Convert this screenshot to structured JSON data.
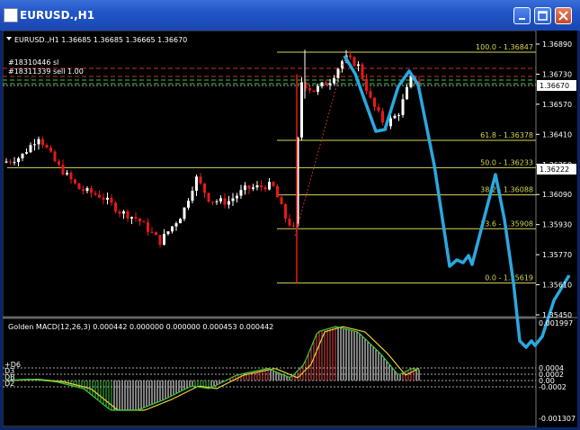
{
  "window": {
    "title": "EURUSD.,H1",
    "buttons": {
      "minimize": "minimize",
      "maximize": "maximize",
      "close": "close"
    }
  },
  "chart_info": {
    "header": "EURUSD.,H1  1.36685 1.36685 1.36665 1.36670"
  },
  "orders": [
    {
      "text": "#18310446 sl"
    },
    {
      "text": "#18311339 sell 1.00"
    }
  ],
  "price_axis": {
    "ticks": [
      "1.36890",
      "1.36730",
      "1.36570",
      "1.36410",
      "1.36250",
      "1.36090",
      "1.35930",
      "1.35770",
      "1.35610",
      "1.35450"
    ],
    "current_price": "1.36670",
    "marked_price": "1.36222"
  },
  "fibonacci": {
    "levels": [
      {
        "label": "100.0 - 1.36847",
        "price": 1.36847
      },
      {
        "label": "61.8 - 1.36378",
        "price": 1.36378
      },
      {
        "label": "50.0 - 1.36233",
        "price": 1.36233
      },
      {
        "label": "38.2 - 1.36088",
        "price": 1.36088
      },
      {
        "label": "23.6 - 1.35908",
        "price": 1.35908
      },
      {
        "label": "0.0 - 1.35619",
        "price": 1.35619
      }
    ]
  },
  "indicator": {
    "title": "Golden MACD(12,26,3) 0.000442 0.000000 0.000000 0.000453 0.000442",
    "axis_ticks": [
      "0.001997",
      "0.0004",
      "0.0002",
      "0.00",
      "-0.0002",
      "-0.001307"
    ],
    "side_labels": [
      "+D6",
      "D3",
      "DB",
      "D2"
    ]
  },
  "chart_data": {
    "type": "candlestick",
    "symbol": "EURUSD.",
    "timeframe": "H1",
    "ylim": [
      1.3545,
      1.3689
    ],
    "ohlc_last": {
      "open": 1.36685,
      "high": 1.36685,
      "low": 1.36665,
      "close": 1.3667
    },
    "fib_levels": [
      1.36847,
      1.36378,
      1.36233,
      1.36088,
      1.35908,
      1.35619
    ],
    "macd_params": [
      12,
      26,
      3
    ],
    "macd_values": [
      0.000442,
      0.0,
      0.0,
      0.000453,
      0.000442
    ],
    "colors": {
      "up": "#ffffff",
      "down": "#e81818",
      "fib": "#d6d65a",
      "projection": "#2aa8e0",
      "order": "#c83030",
      "order_green": "#3cc83c"
    }
  }
}
